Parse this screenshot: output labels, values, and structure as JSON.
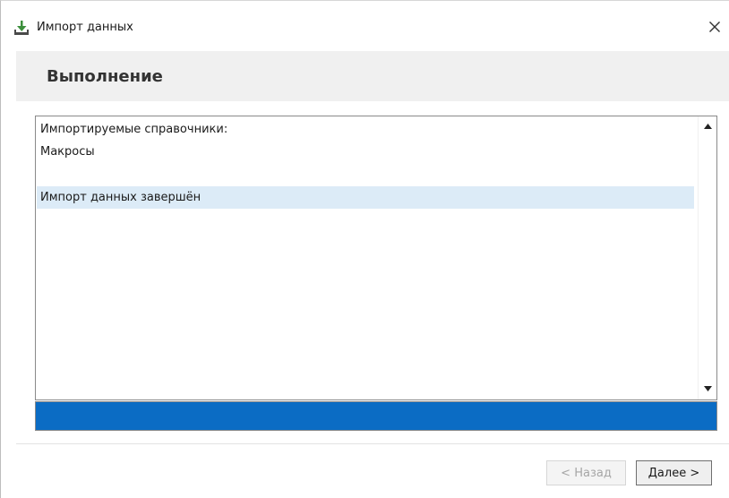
{
  "window": {
    "title": "Импорт данных",
    "close_glyph": "✕"
  },
  "header": {
    "title": "Выполнение"
  },
  "log": {
    "lines": [
      "Импортируемые справочники:",
      "Макросы",
      "",
      "Импорт данных завершён"
    ],
    "highlighted_index": 3
  },
  "progress": {
    "fraction": 1.0
  },
  "buttons": {
    "back_label": "< Назад",
    "back_enabled": false,
    "next_label": "Далее >"
  },
  "icons": {
    "app": "download-tray-icon",
    "close": "close-icon",
    "scroll_up": "triangle-up-icon",
    "scroll_down": "triangle-down-icon"
  },
  "colors": {
    "accent": "#0b6cc4",
    "selection": "#dcebf7",
    "header_band": "#f0f0f0",
    "app_icon_green": "#3c8f3c"
  }
}
